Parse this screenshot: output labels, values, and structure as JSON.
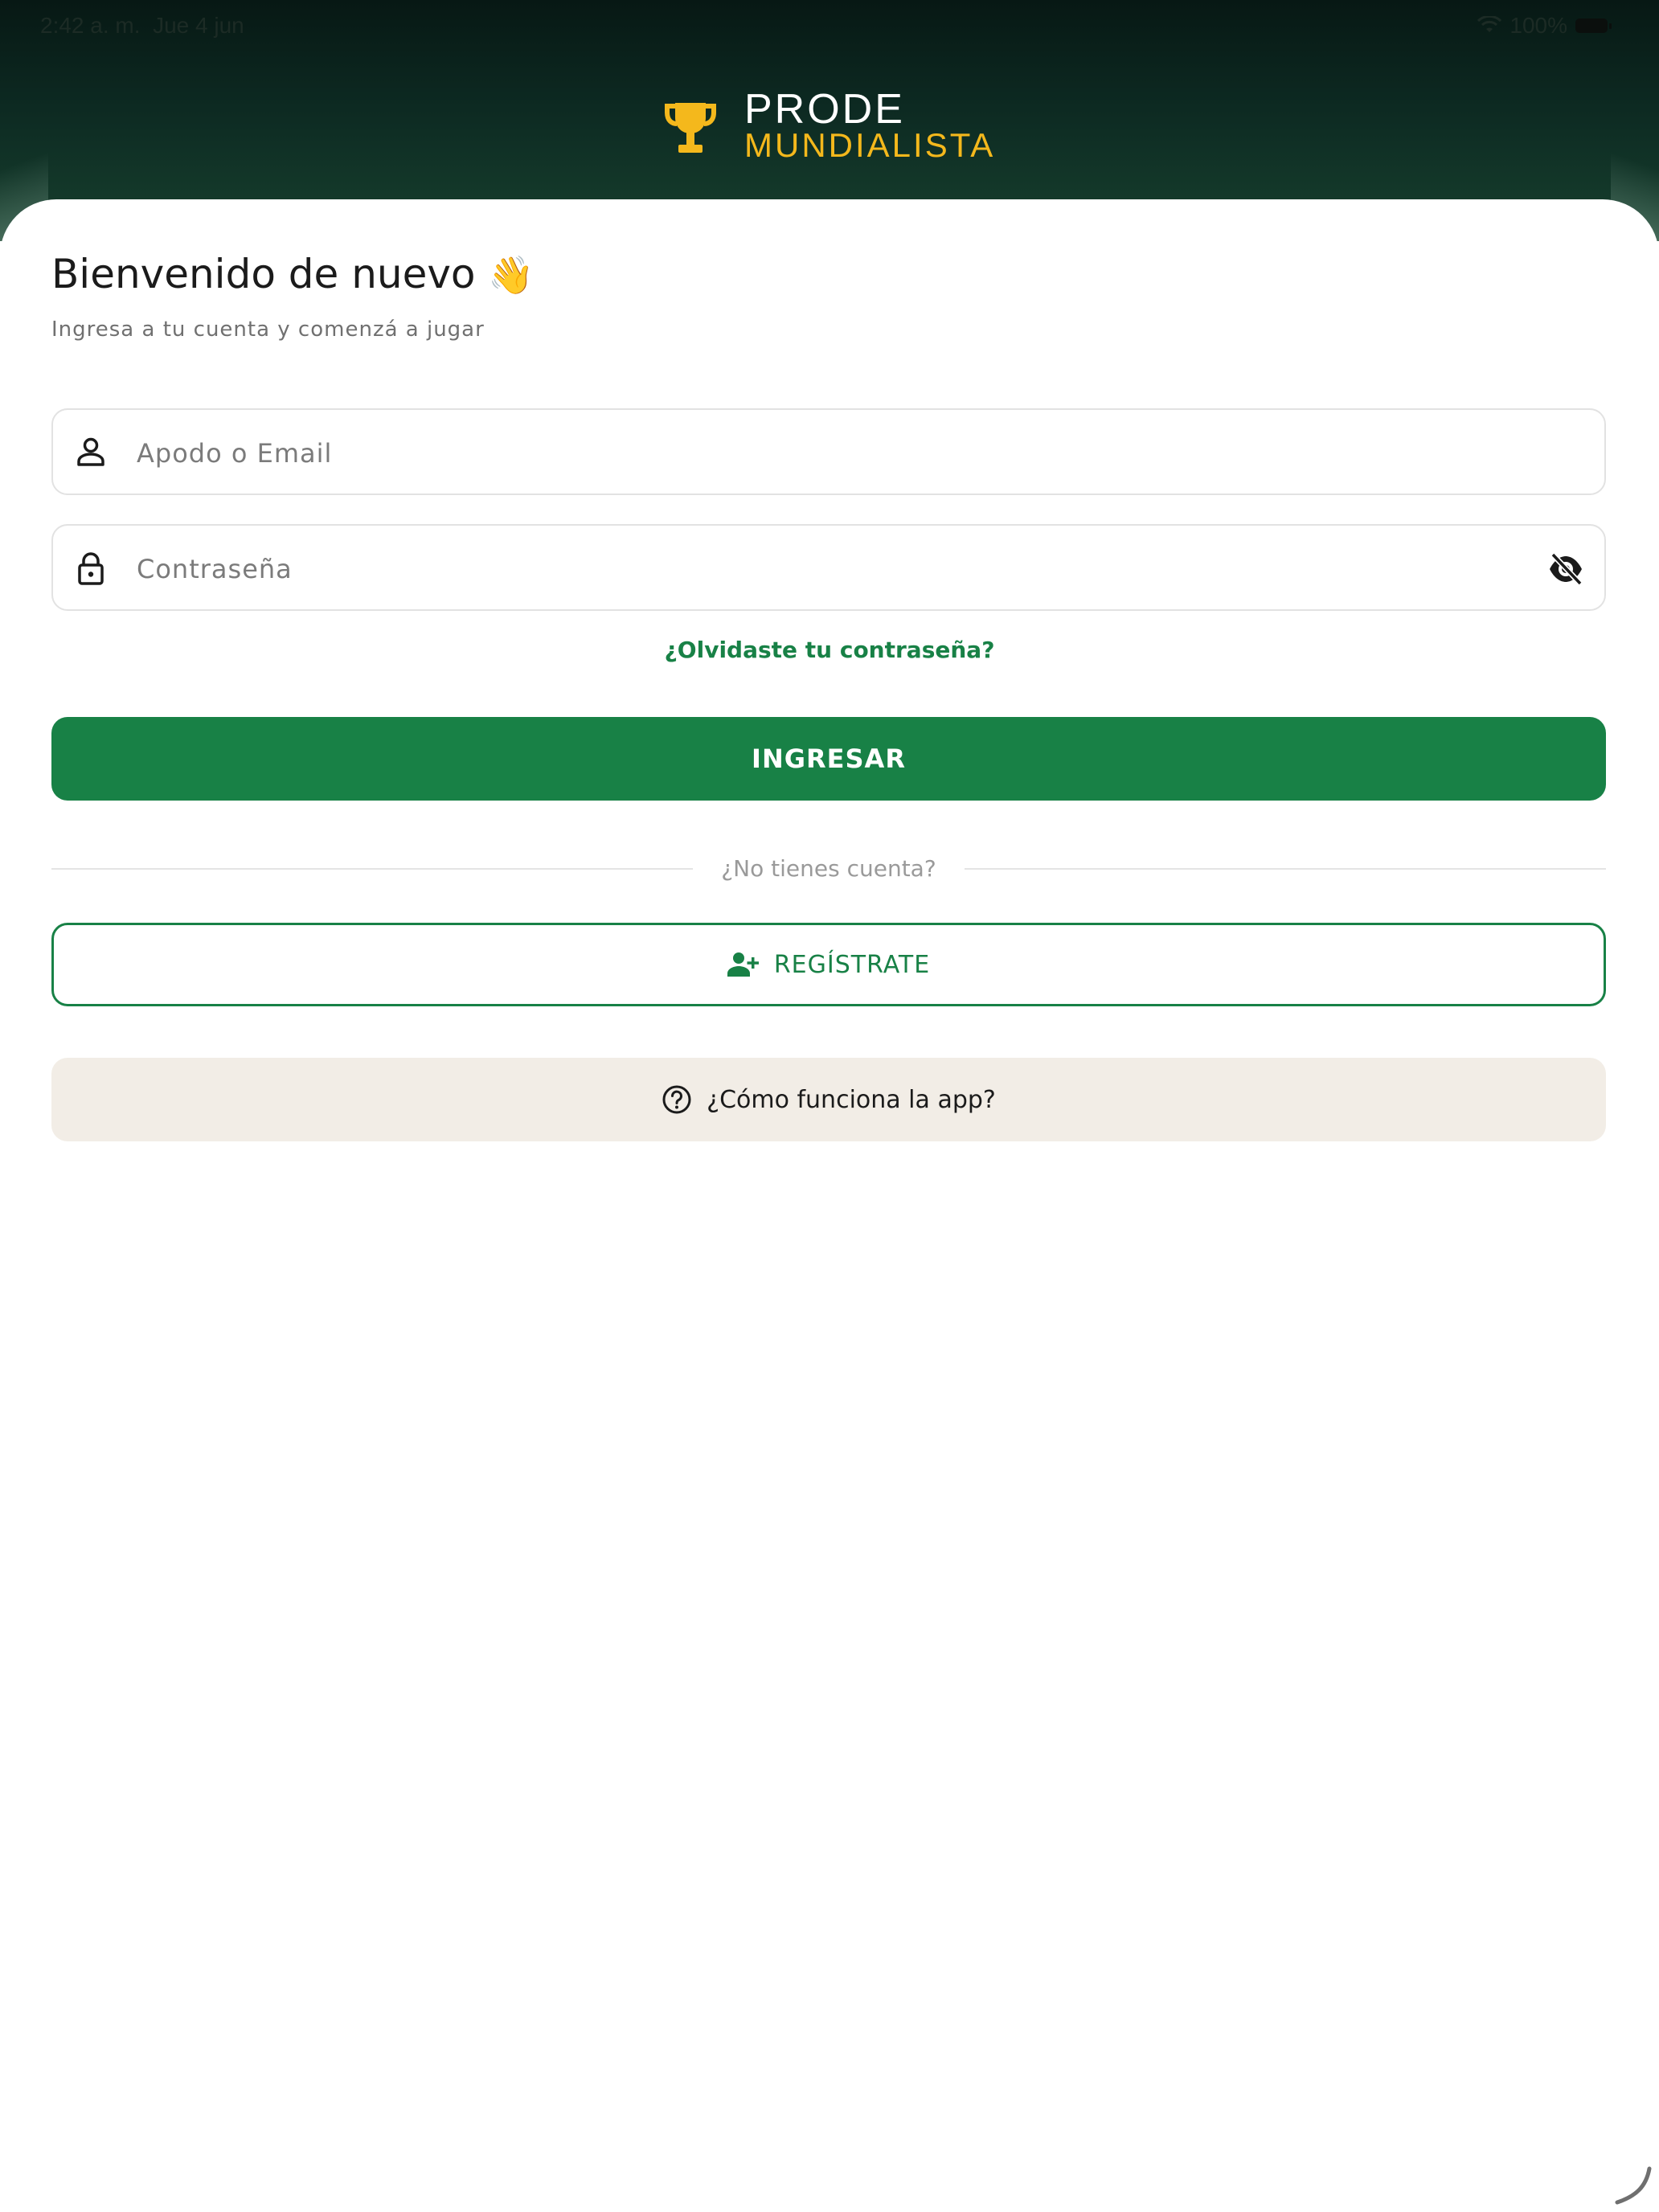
{
  "status_bar": {
    "time": "2:42 a. m.",
    "date": "Jue 4 jun",
    "battery": "100%"
  },
  "logo": {
    "line1": "PRODE",
    "line2": "MUNDIALISTA"
  },
  "welcome": {
    "title": "Bienvenido de nuevo",
    "emoji": "👋",
    "subtitle": "Ingresa a tu cuenta y comenzá a jugar"
  },
  "form": {
    "username_placeholder": "Apodo o Email",
    "password_placeholder": "Contraseña",
    "forgot_link": "¿Olvidaste tu contraseña?",
    "submit_label": "INGRESAR"
  },
  "signup": {
    "divider_text": "¿No tienes cuenta?",
    "register_label": "REGÍSTRATE"
  },
  "help": {
    "label": "¿Cómo funciona la app?"
  },
  "colors": {
    "primary": "#188146",
    "accent_gold": "#f4b81c",
    "header_dark": "#0d2a22",
    "help_bg": "#f2ede6"
  },
  "icons": {
    "logo": "trophy-icon",
    "username": "person-icon",
    "password": "lock-icon",
    "visibility": "eye-off-icon",
    "register": "person-add-icon",
    "help": "question-circle-icon"
  }
}
